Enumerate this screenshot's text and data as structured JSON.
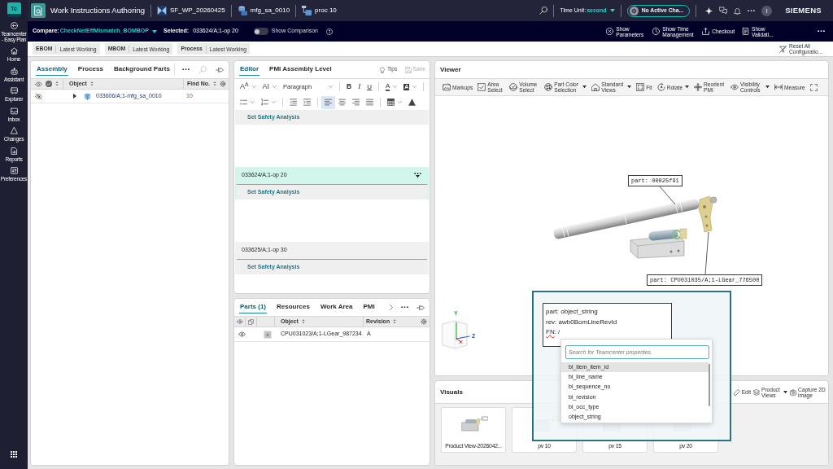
{
  "nav": {
    "logo": "Tc",
    "items": [
      {
        "label": "Teamcenter - Easy Plan",
        "kind": "launch"
      },
      {
        "label": "Home",
        "kind": "home"
      },
      {
        "label": "Assistant",
        "kind": "assistant"
      },
      {
        "label": "Explorer",
        "kind": "explorer"
      },
      {
        "label": "Inbox",
        "kind": "inbox"
      },
      {
        "label": "Changes",
        "kind": "changes"
      },
      {
        "label": "Reports",
        "kind": "reports"
      },
      {
        "label": "Preferences",
        "kind": "preferences"
      }
    ]
  },
  "header": {
    "title": "Work Instructions Authoring",
    "breadcrumbs": [
      {
        "label": "SF_WP_20260425",
        "kind": "package"
      },
      {
        "label": "mfg_sa_0010",
        "kind": "assembly"
      },
      {
        "label": "proc 10",
        "kind": "process"
      }
    ],
    "time_unit": {
      "label": "Time Unit:",
      "value": "second"
    },
    "change": "No Active Cha...",
    "avatar": "I",
    "brand": "SIEMENS"
  },
  "context_bar": {
    "compare": {
      "label": "Compare:",
      "value": "CheckNetEffMismatch_BOMBOP"
    },
    "selected": {
      "label": "Selected:",
      "value": "033624/A;1-op 20"
    },
    "comparison": {
      "label": "Show Comparison",
      "on": false
    },
    "actions": [
      {
        "label": "Show Parameters",
        "kind": "parameters"
      },
      {
        "label": "Show Time Management",
        "kind": "time"
      },
      {
        "label": "Checkout",
        "kind": "checkout"
      },
      {
        "label": "Show Validati...",
        "kind": "validation"
      }
    ]
  },
  "configurations": {
    "items": [
      {
        "name": "EBOM",
        "rule": "Latest Working"
      },
      {
        "name": "MBOM",
        "rule": "Latest Working"
      },
      {
        "name": "Process",
        "rule": "Latest Working"
      }
    ],
    "reset": "Reset All Configuratio..."
  },
  "assembly_panel": {
    "tabs": [
      {
        "label": "Assembly",
        "selected": true
      },
      {
        "label": "Process",
        "selected": false
      },
      {
        "label": "Background Parts",
        "selected": false
      }
    ],
    "columns": [
      "Object",
      "Find No."
    ],
    "rows": [
      {
        "object": "033606/A;1-mfg_sa_0010",
        "find_no": "10",
        "visible": false,
        "expanded": false
      }
    ]
  },
  "editor_panel": {
    "tabs": [
      {
        "label": "Editor",
        "selected": true
      },
      {
        "label": "PMI Assembly Level",
        "selected": false
      }
    ],
    "tips": "Tips",
    "save": {
      "label": "Save",
      "disabled": true
    },
    "toolbar": [
      [
        {
          "kind": "font_size",
          "glyph": "A$^{A}$",
          "menu": true
        },
        {
          "kind": "font_family",
          "glyph": "AI",
          "menu": true
        },
        {
          "kind": "format",
          "glyph": "Paragraph",
          "menu": true
        },
        {
          "kind": "separator"
        },
        {
          "kind": "bold",
          "glyph": "B"
        },
        {
          "kind": "italic",
          "glyph": "I"
        },
        {
          "kind": "underline",
          "glyph": "U"
        },
        {
          "kind": "separator"
        },
        {
          "kind": "font_color",
          "glyph": "A",
          "menu": true
        },
        {
          "kind": "highlight",
          "glyph": "A",
          "menu": true
        },
        {
          "kind": "separator"
        }
      ],
      [
        {
          "kind": "bullets",
          "menu": true
        },
        {
          "kind": "numbering",
          "menu": true
        },
        {
          "kind": "separator"
        },
        {
          "kind": "outdent"
        },
        {
          "kind": "indent"
        },
        {
          "kind": "separator"
        },
        {
          "kind": "align_left",
          "selected": true
        },
        {
          "kind": "align_center",
          "selected": false
        },
        {
          "kind": "align_right",
          "selected": false
        },
        {
          "kind": "justify",
          "selected": false
        },
        {
          "kind": "separator"
        },
        {
          "kind": "table",
          "menu": true
        },
        {
          "kind": "warning"
        }
      ]
    ],
    "sections": [
      {
        "action": "Set Safety Analysis",
        "selected": false
      },
      {
        "title": "033624/A;1-op 20",
        "action": "Set Safety Analysis",
        "selected": true
      },
      {
        "title": "033625/A;1-op 30",
        "action": "Set Safety Analysis",
        "selected": false
      }
    ]
  },
  "parts_panel": {
    "tabs": [
      {
        "label": "Parts (1)",
        "selected": true
      },
      {
        "label": "Resources",
        "selected": false
      },
      {
        "label": "Work Area",
        "selected": false
      },
      {
        "label": "PMI",
        "selected": false
      }
    ],
    "columns": [
      "Object",
      "Revision"
    ],
    "rows": [
      {
        "object": "CPU031023/A;1-LGear_987234",
        "revision": "A",
        "visible": true
      }
    ]
  },
  "viewer": {
    "title": "Viewer",
    "tools": [
      {
        "label": "Markups",
        "kind": "markups"
      },
      {
        "label": "Area Select",
        "kind": "area_select"
      },
      {
        "label": "Volume Select",
        "kind": "volume_select"
      },
      {
        "label": "Part Color Selection",
        "kind": "part_color",
        "menu": true
      },
      {
        "label": "Standard Views",
        "kind": "standard_views",
        "menu": true
      },
      {
        "label": "Fit",
        "kind": "fit"
      },
      {
        "label": "Rotate",
        "kind": "rotate",
        "menu": true
      },
      {
        "label": "Reorient PMI",
        "kind": "reorient"
      },
      {
        "label": "Visibility Controls",
        "kind": "visibility",
        "menu": true
      },
      {
        "label": "Measure",
        "kind": "measure"
      }
    ],
    "callouts": [
      {
        "text": "part: 00025f91"
      },
      {
        "text": "part: CPU031035/A;1-LGear_776500"
      }
    ],
    "axis_labels": [
      "Y",
      "Z"
    ],
    "label_editor": {
      "lines": [
        [
          {
            "text": "part: object_string",
            "misspelled": false
          }
        ],
        [
          {
            "text": "rev: awb0BomLineRevId",
            "misspelled": false
          }
        ],
        [
          {
            "text": "FN",
            "misspelled": true
          },
          {
            "text": ": /",
            "misspelled": false
          }
        ]
      ],
      "search": {
        "placeholder": "Search for Teamcenter properties."
      },
      "options": [
        {
          "label": "bl_item_item_id",
          "selected": true
        },
        {
          "label": "bl_line_name",
          "selected": false
        },
        {
          "label": "bl_sequence_no",
          "selected": false
        },
        {
          "label": "bl_revision",
          "selected": false
        },
        {
          "label": "bl_occ_type",
          "selected": false
        },
        {
          "label": "object_string",
          "selected": false
        }
      ]
    }
  },
  "visuals": {
    "title": "Visuals",
    "actions": [
      {
        "label": "Edit",
        "kind": "edit"
      },
      {
        "label": "Product Views",
        "kind": "views",
        "menu": true
      },
      {
        "label": "Capture 2D image",
        "kind": "capture"
      }
    ],
    "cards": [
      {
        "label": "Product View-2026042..."
      },
      {
        "label": "pv 10"
      },
      {
        "label": "pv 15"
      },
      {
        "label": "pv 20"
      }
    ]
  }
}
